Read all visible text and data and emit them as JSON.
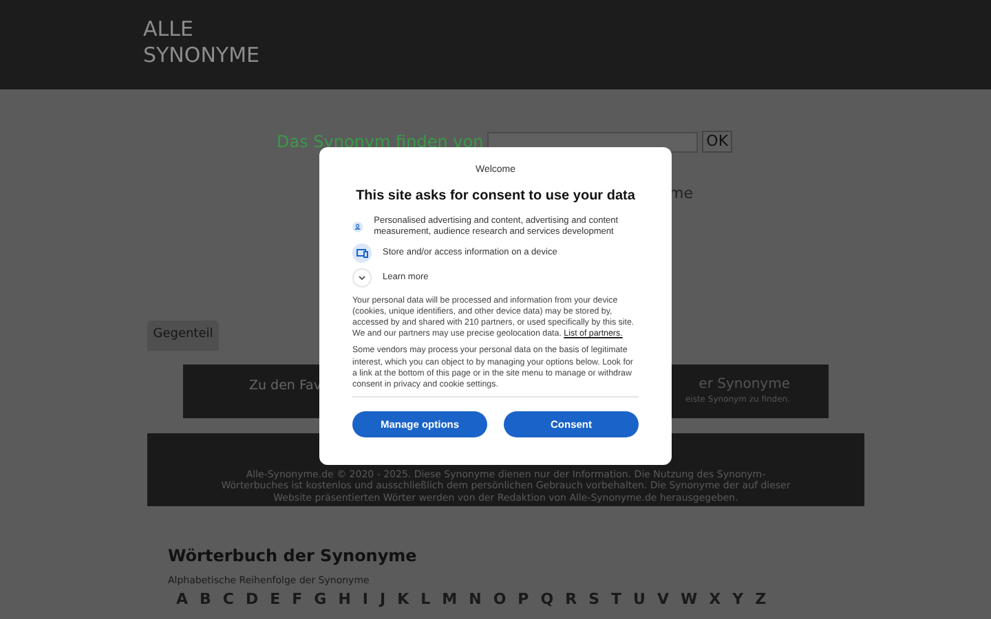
{
  "header": {
    "title_lines": [
      "ALLE",
      "SYNONYME"
    ]
  },
  "search": {
    "label": "Das Synonym finden von",
    "button": "OK"
  },
  "fragment_right": "me",
  "tab": {
    "label": "Gegenteil"
  },
  "promo": {
    "left_title": "Zu den Fav",
    "right_title": "er Synonyme",
    "right_text": "eiste Synonym zu finden."
  },
  "footer": {
    "lines": [
      "Alle-Synonyme.de © 2020 - 2025. Diese Synonyme dienen nur der Information. Die Nutzung des Synonym-",
      "Wörterbuches ist kostenlos und ausschließlich dem persönlichen Gebrauch vorbehalten. Die Synonyme der auf dieser",
      "Website präsentierten Wörter werden von der Redaktion von Alle-Synonyme.de herausgegeben."
    ]
  },
  "dictionary": {
    "title": "Wörterbuch der Synonyme",
    "subtitle": "Alphabetische Reihenfolge der Synonyme",
    "letters": [
      "A",
      "B",
      "C",
      "D",
      "E",
      "F",
      "G",
      "H",
      "I",
      "J",
      "K",
      "L",
      "M",
      "N",
      "O",
      "P",
      "Q",
      "R",
      "S",
      "T",
      "U",
      "V",
      "W",
      "X",
      "Y",
      "Z"
    ]
  },
  "dialog": {
    "kicker": "Welcome",
    "title": "This site asks for consent to use your data",
    "purposes": [
      {
        "kind": "person",
        "text": "Personalised advertising and content, advertising and content measurement, audience research and services development"
      },
      {
        "kind": "device",
        "text": "Store and/or access information on a device"
      },
      {
        "kind": "expand",
        "text": "Learn more"
      }
    ],
    "paragraphs": [
      "Your personal data will be processed and information from your device (cookies, unique identifiers, and other device data) may be stored by, accessed by and shared with 210 partners, or used specifically by this site. We and our partners may use precise geolocation data.",
      "Some vendors may process your personal data on the basis of legitimate interest, which you can object to by managing your options below. Look for a link at the bottom of this page or in the site menu to manage or withdraw consent in privacy and cookie settings."
    ],
    "partners_link": "List of partners.",
    "buttons": [
      "Manage options",
      "Consent"
    ]
  }
}
